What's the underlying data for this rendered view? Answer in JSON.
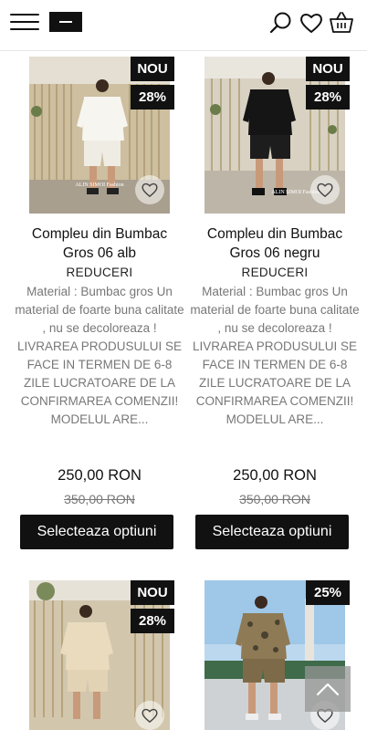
{
  "header": {
    "icons": [
      "menu-icon",
      "logo",
      "search-icon",
      "heart-icon",
      "basket-icon"
    ]
  },
  "products": [
    {
      "badge_new": "NOU",
      "badge_discount": "28%",
      "title": "Compleu din Bumbac Gros 06 alb",
      "category": "REDUCERI",
      "description": "Material : Bumbac gros Un material de foarte buna calitate , nu se decoloreaza ! LIVRAREA PRODUSULUI SE FACE IN TERMEN DE 6-8 ZILE LUCRATOARE DE LA CONFIRMAREA COMENZII! MODELUL ARE...",
      "price": "250,00 RON",
      "old_price": "350,00 RON",
      "button": "Selecteaza optiuni",
      "watermark": "ALIN SIMOI Fashion"
    },
    {
      "badge_new": "NOU",
      "badge_discount": "28%",
      "title": "Compleu din Bumbac Gros 06 negru",
      "category": "REDUCERI",
      "description": "Material : Bumbac gros Un material de foarte buna calitate , nu se decoloreaza ! LIVRAREA PRODUSULUI SE FACE IN TERMEN DE 6-8 ZILE LUCRATOARE DE LA CONFIRMAREA COMENZII! MODELUL ARE...",
      "price": "250,00 RON",
      "old_price": "350,00 RON",
      "button": "Selecteaza optiuni",
      "watermark": "ALIN SIMOI Fashion"
    },
    {
      "badge_new": "NOU",
      "badge_discount": "28%"
    },
    {
      "badge_discount": "25%"
    }
  ],
  "colors": {
    "accent": "#111111",
    "muted": "#777777"
  }
}
